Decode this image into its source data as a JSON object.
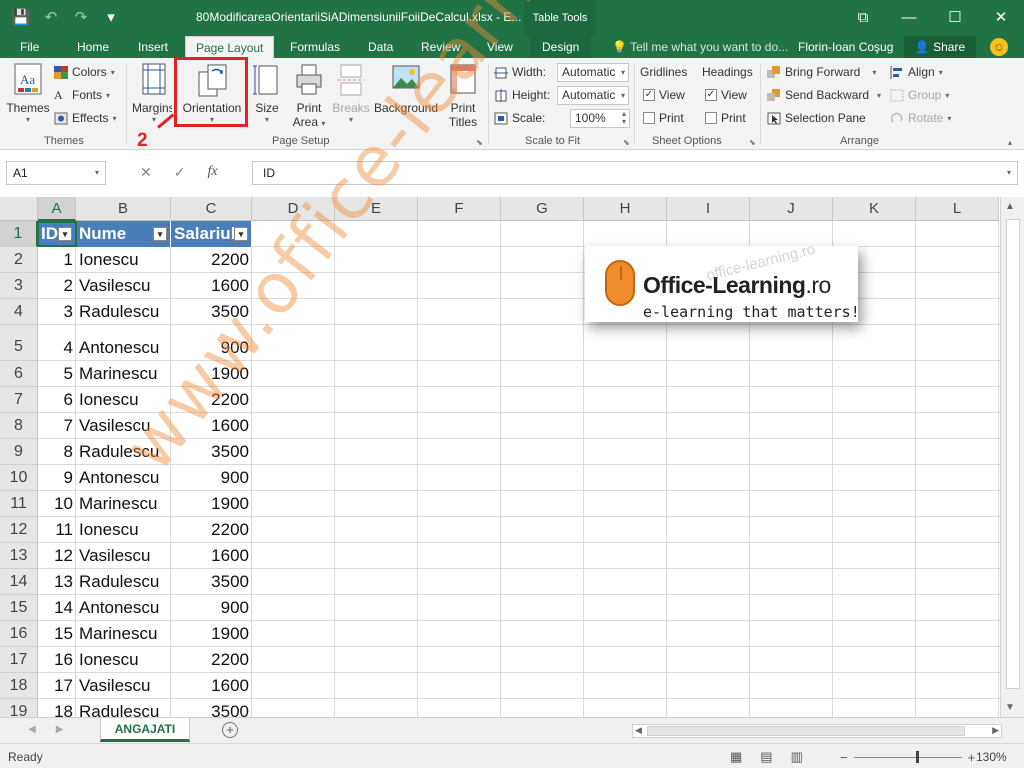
{
  "title_bar": {
    "document_title": "80ModificareaOrientariiSiADimensiuniiFoiiDeCalcul.xlsx - E...",
    "table_tools": "Table Tools"
  },
  "qat": {
    "save": "💾",
    "undo": "↶",
    "redo": "↷",
    "customize": "▾"
  },
  "window_controls": {
    "restore_ribbon": "⧉",
    "minimize": "—",
    "maximize": "☐",
    "close": "✕"
  },
  "tabs": {
    "file": "File",
    "home": "Home",
    "insert": "Insert",
    "page_layout": "Page Layout",
    "formulas": "Formulas",
    "data": "Data",
    "review": "Review",
    "view": "View",
    "design": "Design"
  },
  "tell_me": "Tell me what you want to do...",
  "user_name": "Florin-Ioan Coşug",
  "share_label": "Share",
  "ribbon": {
    "themes": {
      "themes_label": "Themes",
      "colors": "Colors",
      "fonts": "Fonts",
      "effects": "Effects",
      "group_label": "Themes"
    },
    "page_setup": {
      "margins": "Margins",
      "orientation": "Orientation",
      "size": "Size",
      "print_area_1": "Print",
      "print_area_2": "Area",
      "breaks": "Breaks",
      "background": "Background",
      "print_titles_1": "Print",
      "print_titles_2": "Titles",
      "group_label": "Page Setup"
    },
    "scale_to_fit": {
      "width_label": "Width:",
      "width_value": "Automatic",
      "height_label": "Height:",
      "height_value": "Automatic",
      "scale_label": "Scale:",
      "scale_value": "100%",
      "group_label": "Scale to Fit"
    },
    "sheet_options": {
      "gridlines": "Gridlines",
      "headings": "Headings",
      "view": "View",
      "print": "Print",
      "group_label": "Sheet Options"
    },
    "arrange": {
      "bring_forward": "Bring Forward",
      "send_backward": "Send Backward",
      "selection_pane": "Selection Pane",
      "align": "Align",
      "group": "Group",
      "rotate": "Rotate",
      "group_label": "Arrange"
    }
  },
  "annotation_step": "2",
  "formula_bar": {
    "name_box": "A1",
    "cancel": "✕",
    "enter": "✓",
    "fx": "fx",
    "content": "ID"
  },
  "columns": [
    "A",
    "B",
    "C",
    "D",
    "E",
    "F",
    "G",
    "H",
    "I",
    "J",
    "K",
    "L"
  ],
  "table_headers": [
    "ID",
    "Nume",
    "Salariul"
  ],
  "rows": [
    {
      "num": "1"
    },
    {
      "num": "2",
      "id": "1",
      "nume": "Ionescu",
      "salariu": "2200"
    },
    {
      "num": "3",
      "id": "2",
      "nume": "Vasilescu",
      "salariu": "1600"
    },
    {
      "num": "4",
      "id": "3",
      "nume": "Radulescu",
      "salariu": "3500"
    },
    {
      "num": "5",
      "id": "4",
      "nume": "Antonescu",
      "salariu": "900"
    },
    {
      "num": "6",
      "id": "5",
      "nume": "Marinescu",
      "salariu": "1900"
    },
    {
      "num": "7",
      "id": "6",
      "nume": "Ionescu",
      "salariu": "2200"
    },
    {
      "num": "8",
      "id": "7",
      "nume": "Vasilescu",
      "salariu": "1600"
    },
    {
      "num": "9",
      "id": "8",
      "nume": "Radulescu",
      "salariu": "3500"
    },
    {
      "num": "10",
      "id": "9",
      "nume": "Antonescu",
      "salariu": "900"
    },
    {
      "num": "11",
      "id": "10",
      "nume": "Marinescu",
      "salariu": "1900"
    },
    {
      "num": "12",
      "id": "11",
      "nume": "Ionescu",
      "salariu": "2200"
    },
    {
      "num": "13",
      "id": "12",
      "nume": "Vasilescu",
      "salariu": "1600"
    },
    {
      "num": "14",
      "id": "13",
      "nume": "Radulescu",
      "salariu": "3500"
    },
    {
      "num": "15",
      "id": "14",
      "nume": "Antonescu",
      "salariu": "900"
    },
    {
      "num": "16",
      "id": "15",
      "nume": "Marinescu",
      "salariu": "1900"
    },
    {
      "num": "17",
      "id": "16",
      "nume": "Ionescu",
      "salariu": "2200"
    },
    {
      "num": "18",
      "id": "17",
      "nume": "Vasilescu",
      "salariu": "1600"
    },
    {
      "num": "19",
      "id": "18",
      "nume": "Radulescu",
      "salariu": "3500"
    }
  ],
  "logo": {
    "brand": "Office-Learning",
    "brand_tld": ".ro",
    "tagline": "e-learning that matters!",
    "ghost": "office-learning.ro"
  },
  "watermark": "www.office-learning.ro",
  "sheet_tab": "ANGAJATI",
  "add_sheet": "+",
  "status": {
    "ready": "Ready",
    "zoom_minus": "−",
    "zoom_plus": "+",
    "zoom_level": "130%"
  },
  "colors": {
    "excel_green": "#217346",
    "table_header_blue": "#4a7ebb",
    "annotation_red": "#e0232a",
    "watermark_orange": "#f08c3c"
  }
}
